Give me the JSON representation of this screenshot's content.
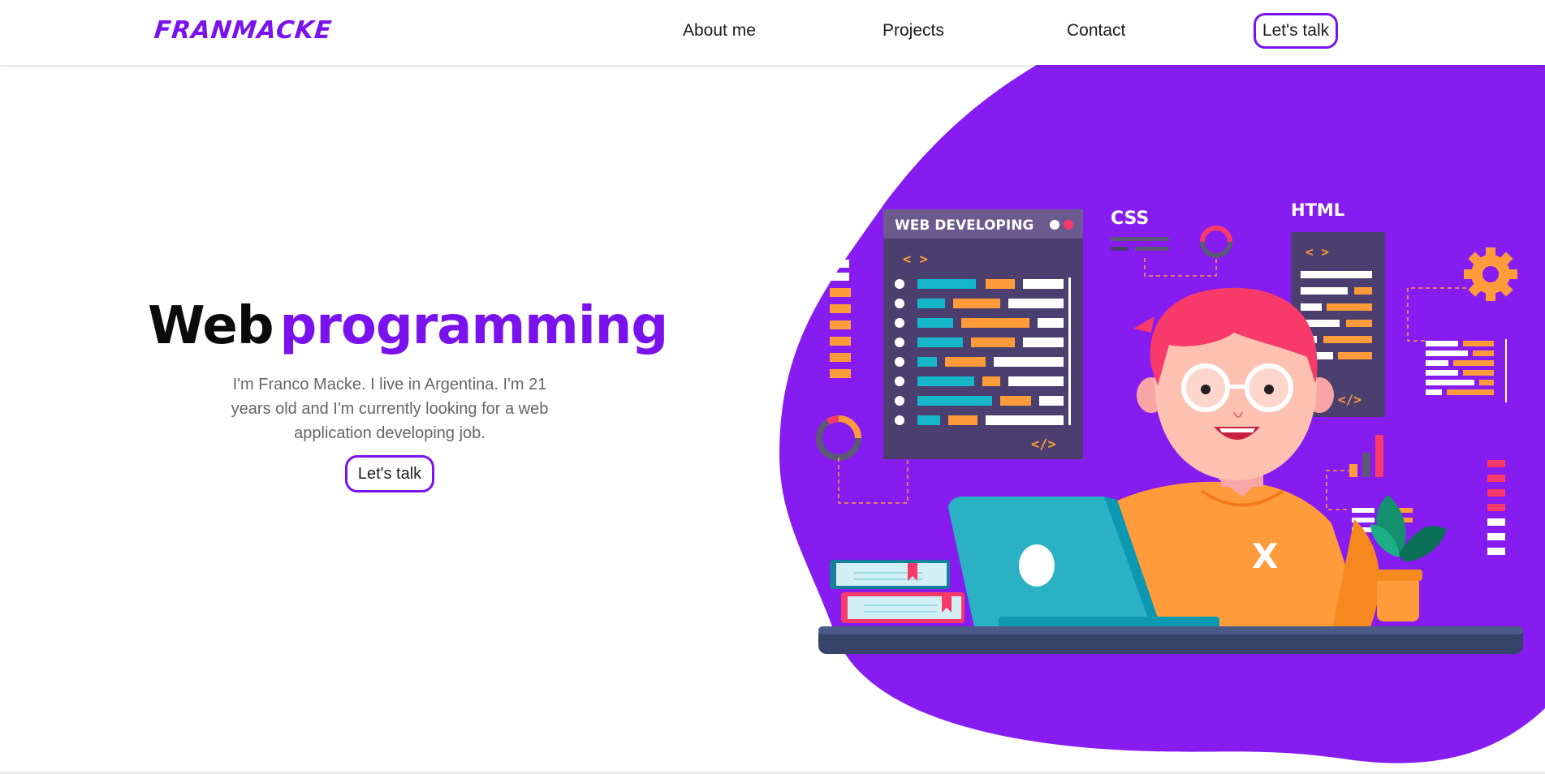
{
  "brand": {
    "logo": "FRANMACKE",
    "accent": "#7a12ee"
  },
  "nav": {
    "links": [
      "About me",
      "Projects",
      "Contact"
    ],
    "cta": "Let's talk"
  },
  "hero": {
    "title_word1": "Web",
    "title_word2": "programming",
    "description": "I'm Franco Macke. I live in Argentina. I'm 21 years old and I'm currently looking for a web application developing job.",
    "cta": "Let's talk"
  },
  "illustration": {
    "panel_title": "WEB DEVELOPING",
    "css_label": "CSS",
    "html_label": "HTML",
    "code_open": "< >",
    "code_close": "</>",
    "shirt_mark": "X"
  }
}
